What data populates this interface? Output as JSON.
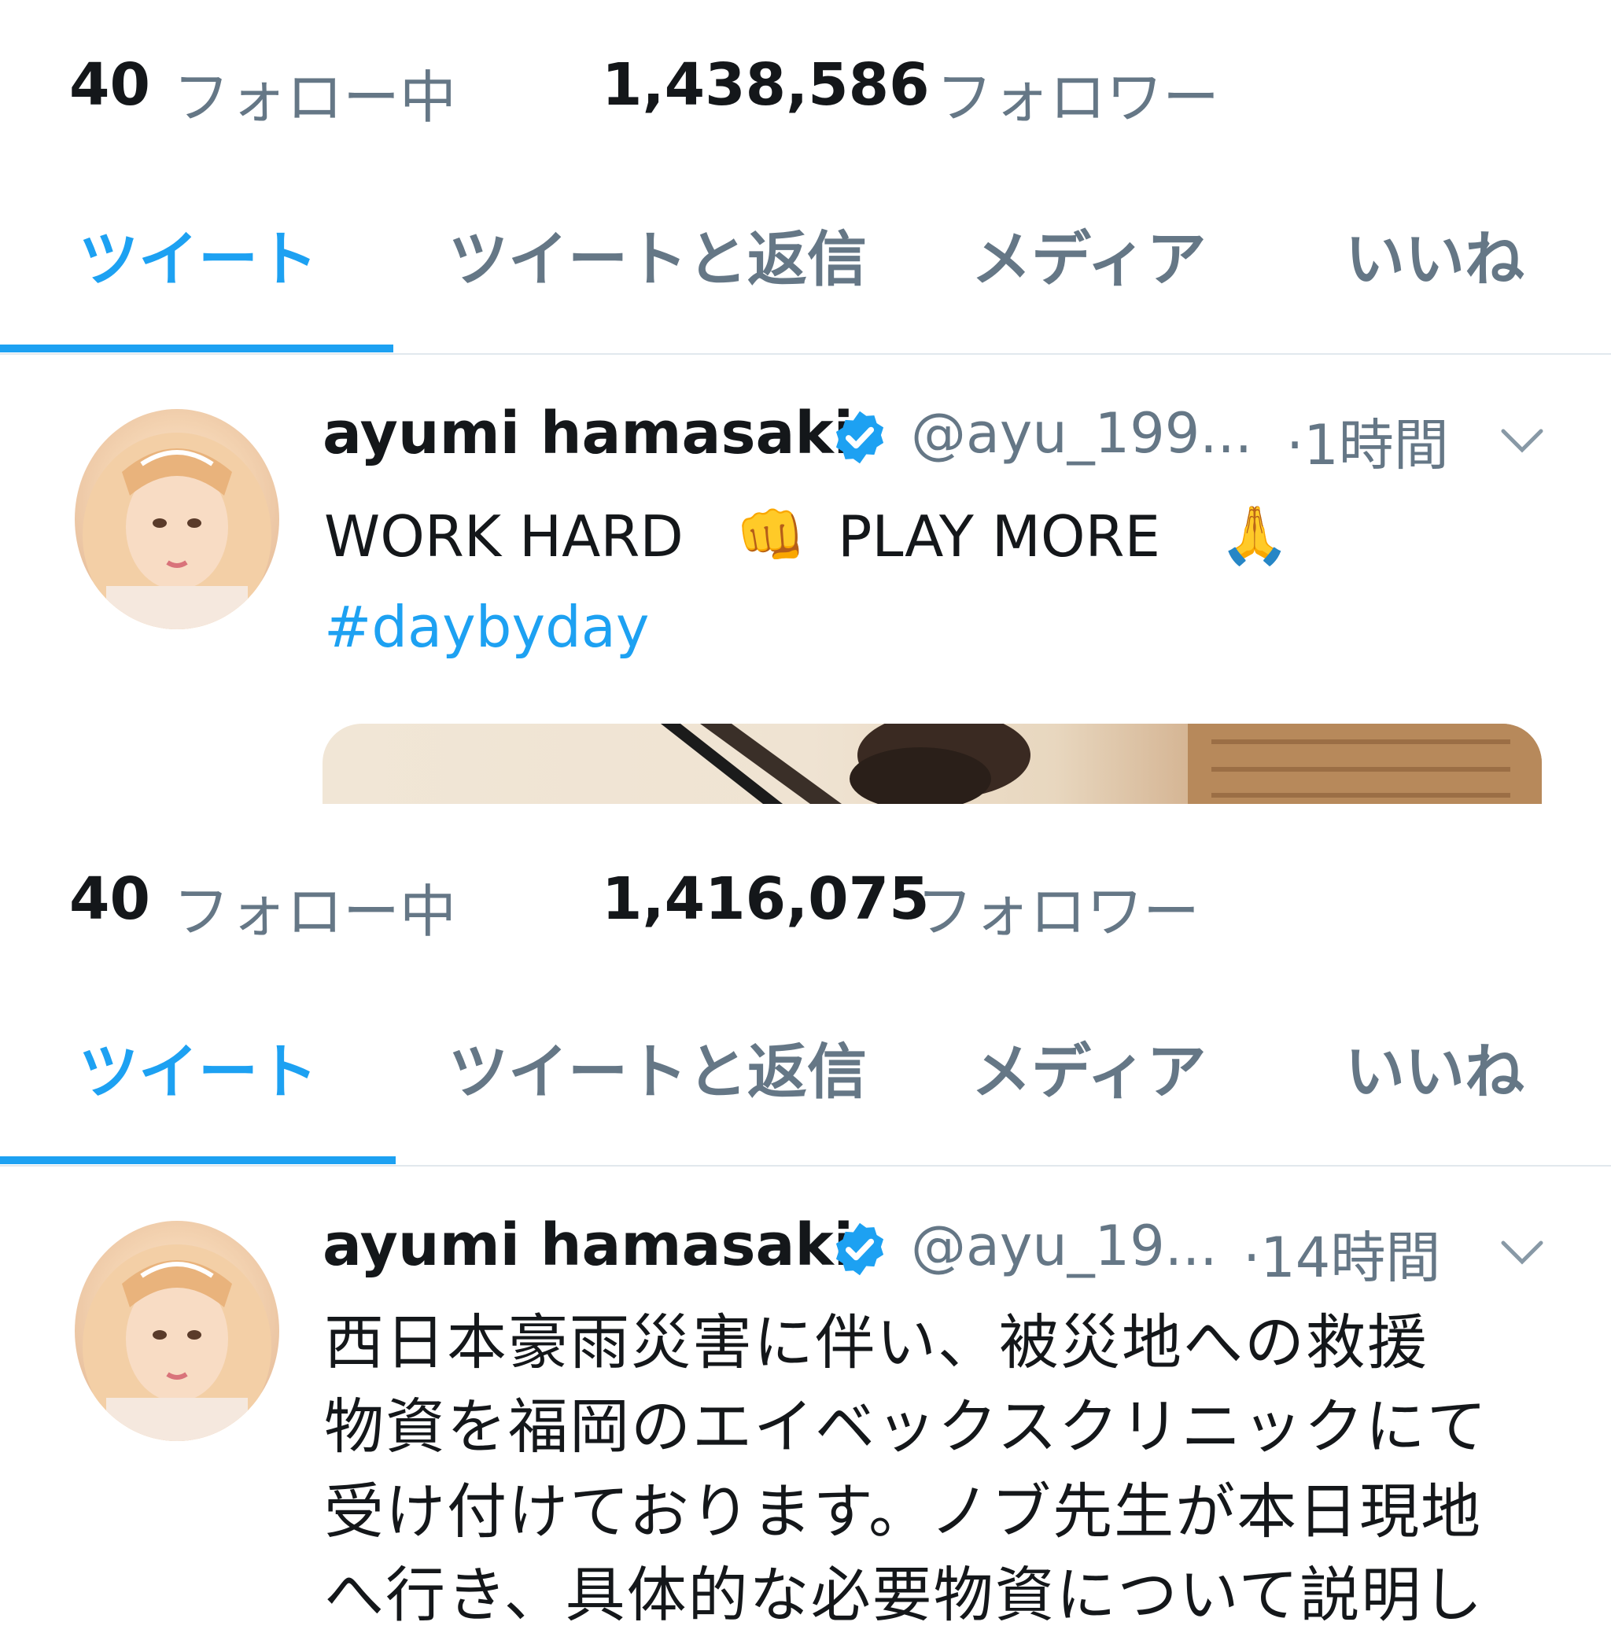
{
  "profile_sections": [
    {
      "following_count": "40",
      "following_label": "フォロー中",
      "followers_count": "1,438,586",
      "followers_label": "フォロワー",
      "tabs": [
        "ツイート",
        "ツイートと返信",
        "メディア",
        "いいね"
      ],
      "active_tab": "ツイート",
      "tweet": {
        "author_name": "ayumi hamasaki",
        "handle": "@ayu_199...",
        "time": "·1時間",
        "text_part1": "WORK HARD",
        "emoji1": "👊",
        "text_part2": "PLAY MORE",
        "emoji2": "🙏",
        "hashtag": "#daybyday"
      }
    },
    {
      "following_count": "40",
      "following_label": "フォロー中",
      "followers_count": "1,416,075",
      "followers_label": "フォロワー",
      "tabs": [
        "ツイート",
        "ツイートと返信",
        "メディア",
        "いいね"
      ],
      "active_tab": "ツイート",
      "tweet": {
        "author_name": "ayumi hamasaki",
        "handle": "@ayu_19...",
        "time": "·14時間",
        "lines": [
          "西日本豪雨災害に伴い、被災地への救援",
          "物資を福岡のエイベックスクリニックにて",
          "受け付けております。ノブ先生が本日現地",
          "へ行き、具体的な必要物資について説明し"
        ]
      }
    }
  ],
  "colors": {
    "accent": "#1da1f2",
    "text": "#14171a",
    "secondary": "#657786",
    "border": "#e1e8ed"
  },
  "icons": [
    "verified-badge-icon",
    "chevron-down-icon"
  ]
}
